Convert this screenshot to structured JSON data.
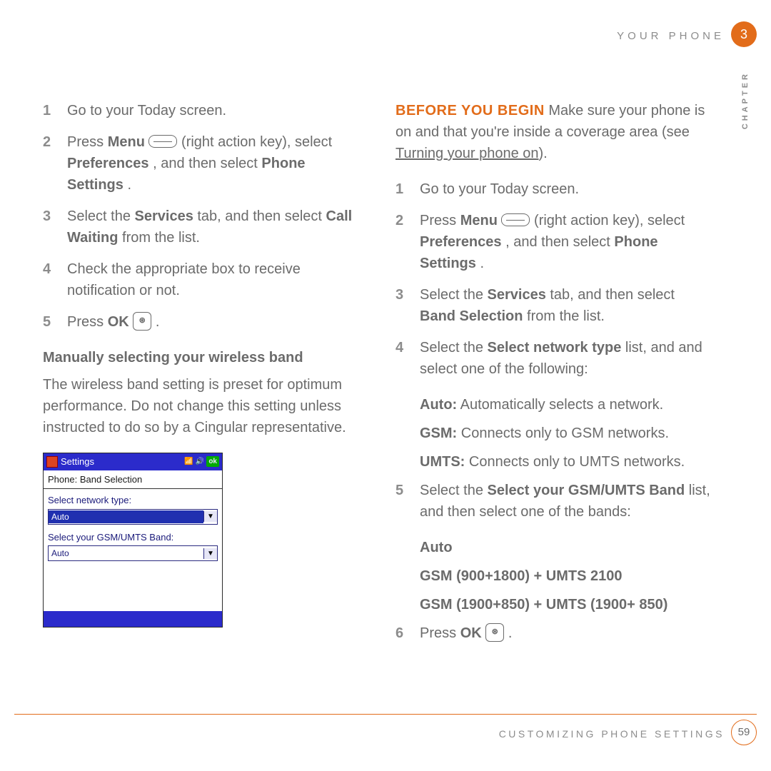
{
  "header": {
    "section": "YOUR PHONE",
    "chapter_num": "3",
    "sidebar": "CHAPTER"
  },
  "footer": {
    "section": "CUSTOMIZING PHONE SETTINGS",
    "page": "59"
  },
  "left": {
    "steps": [
      {
        "n": "1",
        "t": "Go to your Today screen."
      },
      {
        "n": "2",
        "p1": "Press ",
        "b1": "Menu",
        "p2": " (right action key), select ",
        "b2": "Preferences",
        "p3": ", and then select ",
        "b3": "Phone Settings",
        "p4": "."
      },
      {
        "n": "3",
        "p1": "Select the ",
        "b1": "Services",
        "p2": " tab, and then select ",
        "b2": "Call Waiting",
        "p3": " from the list."
      },
      {
        "n": "4",
        "t": "Check the appropriate box to receive notification or not."
      },
      {
        "n": "5",
        "p1": "Press ",
        "b1": "OK",
        "p2": " ."
      }
    ],
    "subhead": "Manually selecting your wireless band",
    "para": "The wireless band setting is preset for optimum performance. Do not change this setting unless instructed to do so by a Cingular representative."
  },
  "right": {
    "pre": {
      "accent": "BEFORE YOU BEGIN",
      "t1": "  Make sure your phone is on and that you're inside a coverage area (see ",
      "link": "Turning your phone on",
      "t2": ")."
    },
    "steps": [
      {
        "n": "1",
        "t": "Go to your Today screen."
      },
      {
        "n": "2",
        "p1": "Press ",
        "b1": "Menu",
        "p2": " (right action key), select ",
        "b2": "Preferences",
        "p3": ", and then select ",
        "b3": "Phone Settings",
        "p4": "."
      },
      {
        "n": "3",
        "p1": "Select the ",
        "b1": "Services",
        "p2": " tab, and then select ",
        "b2": "Band Selection",
        "p3": " from the list."
      },
      {
        "n": "4",
        "p1": "Select the ",
        "b1": "Select network type",
        "p2": " list, and and select one of the following:"
      },
      {
        "n": "5",
        "p1": "Select the ",
        "b1": "Select your GSM/UMTS Band",
        "p2": " list, and then select one of the bands:"
      },
      {
        "n": "6",
        "p1": "Press ",
        "b1": "OK",
        "p2": " ."
      }
    ],
    "opts4": [
      {
        "b": "Auto:",
        "t": " Automatically selects a network."
      },
      {
        "b": "GSM:",
        "t": " Connects only to GSM networks."
      },
      {
        "b": "UMTS:",
        "t": " Connects only to UMTS networks."
      }
    ],
    "opts5": [
      {
        "b": "Auto",
        "t": ""
      },
      {
        "b": "GSM (900+1800) + UMTS 2100",
        "t": ""
      },
      {
        "b": "GSM (1900+850) + UMTS (1900+ 850)",
        "t": ""
      }
    ]
  },
  "screenshot": {
    "title": "Settings",
    "ok": "ok",
    "crumb": "Phone:  Band Selection",
    "label1": "Select network type:",
    "val1": "Auto",
    "label2": "Select your GSM/UMTS Band:",
    "val2": "Auto"
  }
}
